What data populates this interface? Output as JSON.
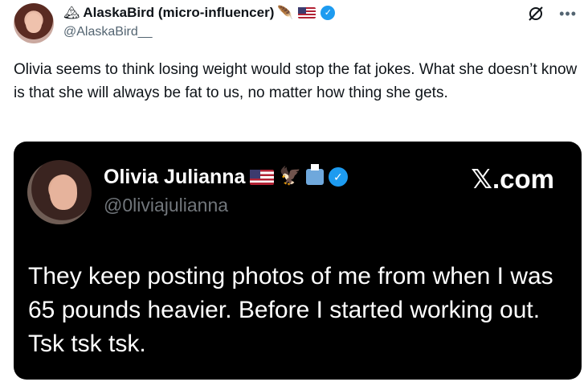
{
  "post": {
    "author": {
      "display_name": "AlaskaBird (micro-influencer)",
      "badge_emojis": "🪶",
      "handle": "@AlaskaBird__",
      "verified": true
    },
    "text": "Olivia seems to think losing weight would stop the fat jokes. What she doesn’t know is that she will always be fat to us, no matter how thing she gets.",
    "actions": {
      "more_label": "•••"
    }
  },
  "embedded_screenshot": {
    "author": {
      "display_name": "Olivia Julianna",
      "emojis": "🦅",
      "handle": "@0liviajulianna",
      "verified": true
    },
    "watermark": "𝕏.com",
    "text": "They keep posting photos of me from when I was 65 pounds heavier. Before I started working out. Tsk tsk tsk."
  },
  "colors": {
    "verified_blue": "#1d9bf0",
    "handle_gray": "#536471",
    "media_bg": "#000000"
  }
}
